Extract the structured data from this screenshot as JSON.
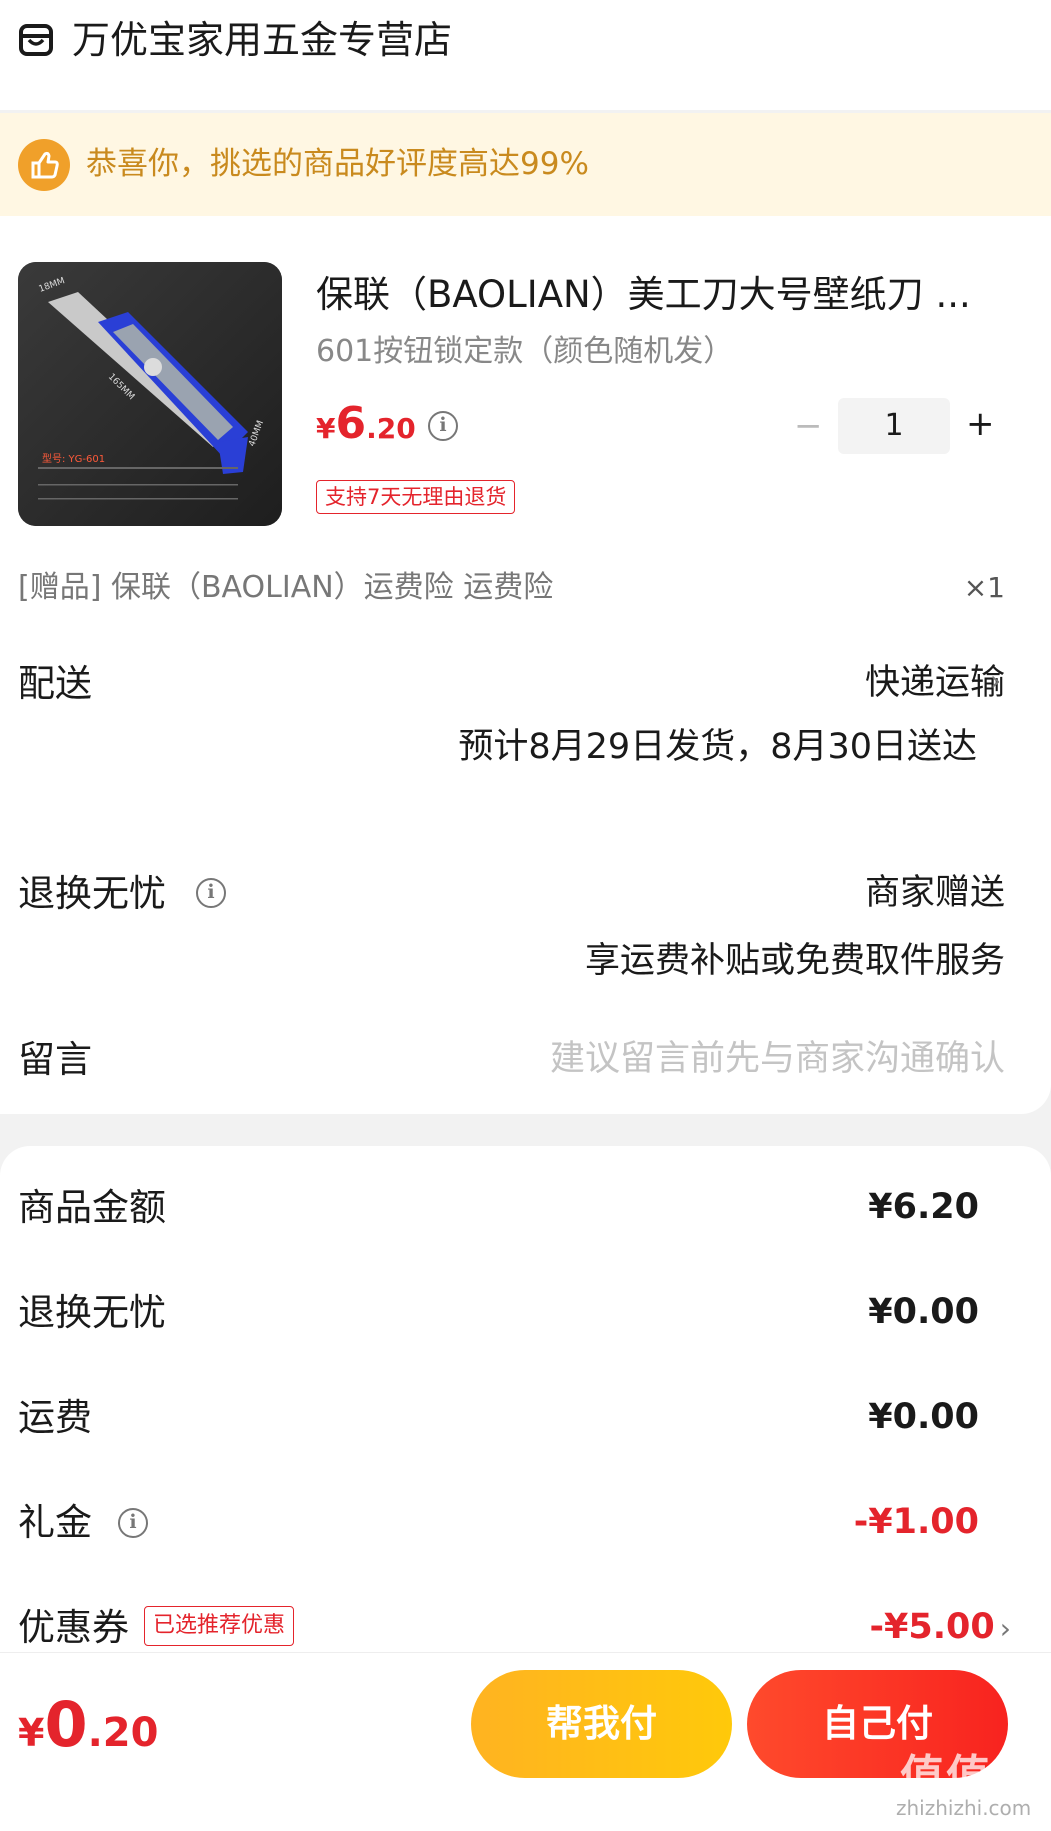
{
  "store": {
    "name": "万优宝家用五金专营店",
    "icon": "store-icon"
  },
  "banner": {
    "text": "恭喜你，挑选的商品好评度高达99%",
    "icon": "thumbs-up-icon"
  },
  "product": {
    "title": "保联（BAOLIAN）美工刀大号壁纸刀 ...",
    "spec": "601按钮锁定款（颜色随机发）",
    "price_symbol": "¥",
    "price_int": "6",
    "price_dec": ".20",
    "quantity": "1",
    "minus": "−",
    "plus": "+",
    "return_tag": "支持7天无理由退货",
    "image_label": "型号: YG-601",
    "image_dims": [
      "18MM",
      "165MM",
      "40MM"
    ]
  },
  "gift": {
    "text": "[赠品] 保联（BAOLIAN）运费险 运费险",
    "qty": "×1"
  },
  "delivery": {
    "label": "配送",
    "method": "快递运输",
    "estimate": "预计8月29日发货，8月30日送达"
  },
  "returns": {
    "label": "退换无忧",
    "value": "商家赠送",
    "detail": "享运费补贴或免费取件服务"
  },
  "message": {
    "label": "留言",
    "placeholder": "建议留言前先与商家沟通确认"
  },
  "summary": {
    "goods": {
      "label": "商品金额",
      "value": "¥6.20"
    },
    "returns": {
      "label": "退换无忧",
      "value": "¥0.00"
    },
    "shipping": {
      "label": "运费",
      "value": "¥0.00"
    },
    "gift_money": {
      "label": "礼金",
      "value": "-¥1.00"
    },
    "coupon": {
      "label": "优惠券",
      "tag": "已选推荐优惠",
      "value": "-¥5.00"
    }
  },
  "footer": {
    "total_symbol": "¥",
    "total_int": "0",
    "total_dec": ".20",
    "help_pay": "帮我付",
    "self_pay": "自己付"
  },
  "watermark": {
    "text": "值值值",
    "url": "zhizhizhi.com"
  },
  "colors": {
    "accent_red": "#e4242c",
    "banner_bg": "#fff7e3",
    "banner_text": "#c98a1e",
    "help_btn": "#ffb321",
    "self_btn": "#f8231f"
  }
}
